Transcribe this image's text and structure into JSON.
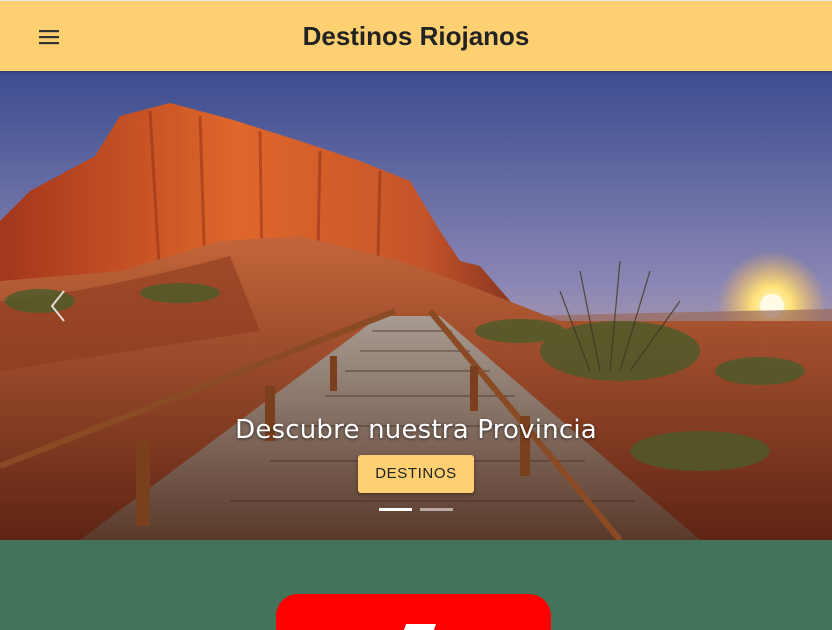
{
  "header": {
    "menu_icon": "hamburger-menu-icon",
    "title": "Destinos Riojanos",
    "background": "#fed072"
  },
  "hero": {
    "image": "red-rock-canyon-boardwalk-sunset",
    "prev_icon": "chevron-left-icon",
    "caption": "Descubre nuestra Provincia",
    "button_label": "DESTINOS",
    "slide_count": 2,
    "active_slide": 1
  },
  "section": {
    "background": "#43735a",
    "card_color": "#ff0000"
  }
}
